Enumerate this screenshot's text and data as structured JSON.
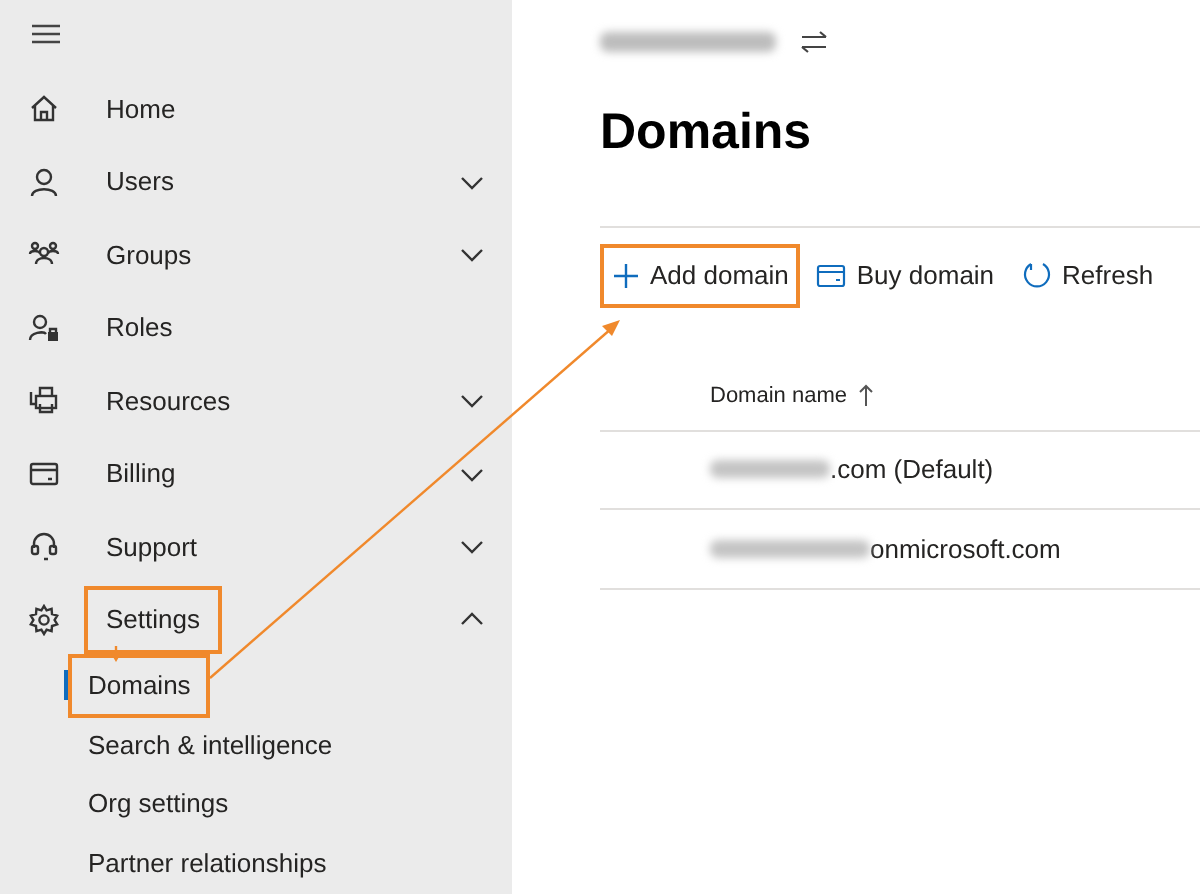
{
  "sidebar": {
    "items": [
      {
        "label": "Home",
        "highlighted": false
      },
      {
        "label": "Users",
        "expanded": false,
        "highlighted": false
      },
      {
        "label": "Groups",
        "expanded": false,
        "highlighted": false
      },
      {
        "label": "Roles",
        "highlighted": false
      },
      {
        "label": "Resources",
        "expanded": false,
        "highlighted": false
      },
      {
        "label": "Billing",
        "expanded": false,
        "highlighted": false
      },
      {
        "label": "Support",
        "expanded": false,
        "highlighted": false
      },
      {
        "label": "Settings",
        "expanded": true,
        "highlighted": true,
        "children": [
          {
            "label": "Domains",
            "selected": true,
            "highlighted": true
          },
          {
            "label": "Search & intelligence",
            "selected": false,
            "highlighted": false
          },
          {
            "label": "Org settings",
            "selected": false,
            "highlighted": false
          },
          {
            "label": "Partner relationships",
            "selected": false,
            "highlighted": false
          }
        ]
      }
    ]
  },
  "page": {
    "title": "Domains"
  },
  "toolbar": [
    {
      "label": "Add domain",
      "highlighted": true
    },
    {
      "label": "Buy domain",
      "highlighted": false
    },
    {
      "label": "Refresh",
      "highlighted": false
    }
  ],
  "table": {
    "columns": [
      {
        "label": "Domain name",
        "sorted": true
      }
    ],
    "rows": [
      {
        "domain": ".com (Default)"
      },
      {
        "domain": "onmicrosoft.com"
      }
    ]
  }
}
